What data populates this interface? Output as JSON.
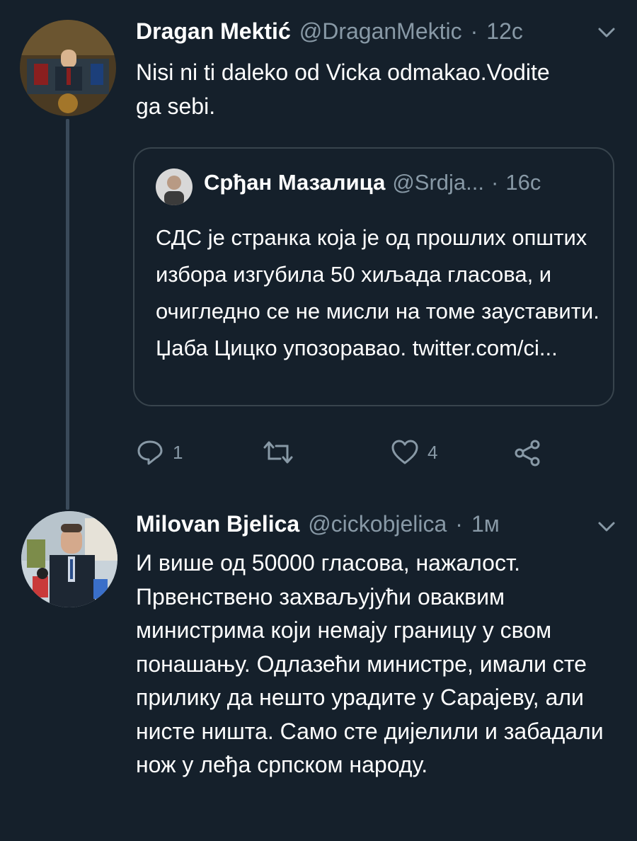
{
  "tweet1": {
    "name": "Dragan Mektić",
    "handle": "@DraganMektic",
    "separator": "·",
    "time": "12c",
    "text": "Nisi ni ti daleko od Vicka odmakao.Vodite ga sebi.",
    "quote": {
      "name": "Срђан Мазалица",
      "handle": "@Srdja...",
      "separator": "·",
      "time": "16c",
      "text": "СДС је странка која је од прошлих општих избора изгубила 50 хиљада гласова, и очигледно се не мисли на томе зауставити. Џаба Цицко упозоравао. twitter.com/ci..."
    },
    "actions": {
      "reply_count": "1",
      "retweet_count": "",
      "like_count": "4"
    }
  },
  "tweet2": {
    "name": "Milovan Bjelica",
    "handle": "@cickobjelica",
    "separator": "·",
    "time": "1м",
    "text": "И више од 50000 гласова, нажалост. Првенствено захваљујући оваквим министрима који немају границу у свом понашању. Одлазећи министре, имали сте прилику да нешто урадите у Сарајеву, али нисте ништа. Само сте дијелили и забадали нож у леђа српском народу."
  },
  "icons": {
    "reply": "reply-icon",
    "retweet": "retweet-icon",
    "like": "heart-icon",
    "share": "share-icon",
    "menu": "chevron-down-icon"
  },
  "colors": {
    "background": "#15202b",
    "secondary_text": "#8899a6",
    "border": "#38444d"
  }
}
